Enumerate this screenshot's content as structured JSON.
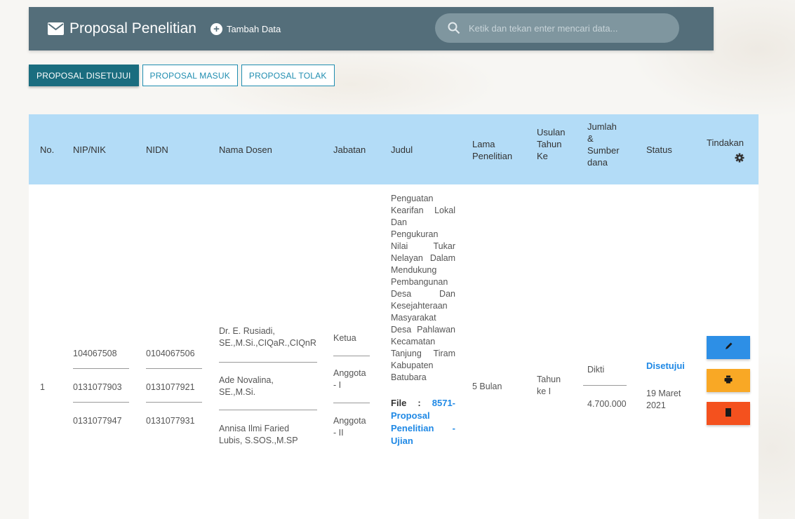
{
  "header": {
    "title": "Proposal Penelitian",
    "add_label": "Tambah Data",
    "search_placeholder": "Ketik dan tekan enter mencari data..."
  },
  "tabs": [
    {
      "label": "PROPOSAL DISETUJUI",
      "active": true
    },
    {
      "label": "PROPOSAL MASUK",
      "active": false
    },
    {
      "label": "PROPOSAL TOLAK",
      "active": false
    }
  ],
  "table": {
    "columns": {
      "no": "No.",
      "nip": "NIP/NIK",
      "nidn": "NIDN",
      "nama": "Nama Dosen",
      "jabatan": "Jabatan",
      "judul": "Judul",
      "lama": "Lama Penelitian",
      "usulan": "Usulan Tahun Ke",
      "jumlah": "Jumlah & Sumber dana",
      "status": "Status",
      "tindakan": "Tindakan"
    },
    "row": {
      "no": "1",
      "members": [
        {
          "nip": "104067508",
          "nidn": "0104067506",
          "nama": "Dr. E. Rusiadi, SE.,M.Si.,CIQaR.,CIQnR",
          "jabatan": "Ketua"
        },
        {
          "nip": "0131077903",
          "nidn": "0131077921",
          "nama": "Ade Novalina, SE.,M.Si.",
          "jabatan": "Anggota - I"
        },
        {
          "nip": "0131077947",
          "nidn": "0131077931",
          "nama": "Annisa Ilmi Faried Lubis, S.SOS.,M.SP",
          "jabatan": "Anggota - II"
        }
      ],
      "judul": "Penguatan Kearifan Lokal Dan Pengukuran Nilai Tukar Nelayan Dalam Mendukung Pembangunan Desa Dan Kesejahteraan Masyarakat Desa Pahlawan Kecamatan Tanjung Tiram Kabupaten Batubara",
      "file_label": "File : ",
      "file_link": "8571-Proposal Penelitian - Ujian",
      "lama": "5 Bulan",
      "usulan": "Tahun ke I",
      "sumber": "Dikti",
      "jumlah": "4.700.000",
      "status": "Disetujui",
      "tanggal": "19 Maret 2021"
    }
  },
  "colors": {
    "header_bg": "#546e7a",
    "table_head_bg": "#b3dcf7",
    "active_tab": "#1a6d7f",
    "edit": "#2d8fe6",
    "print": "#f9a825",
    "delete": "#f4511e",
    "link": "#1e88e5"
  },
  "icons": [
    "mail-icon",
    "plus-circle-icon",
    "search-icon",
    "gear-icon",
    "pencil-icon",
    "print-icon",
    "trash-icon"
  ]
}
